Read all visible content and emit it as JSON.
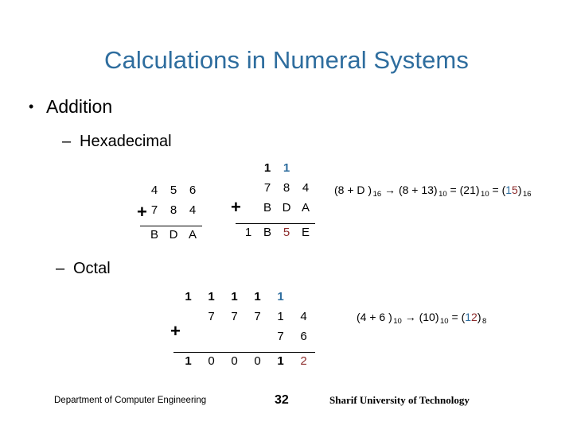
{
  "slide": {
    "title": "Calculations in Numeral Systems",
    "bullets": {
      "level1": {
        "mark": "•",
        "label": "Addition"
      },
      "hexadecimal": {
        "mark": "–",
        "label": "Hexadecimal"
      },
      "octal": {
        "mark": "–",
        "label": "Octal"
      }
    }
  },
  "hex_block_1": {
    "plus": "+",
    "carry": [
      "",
      "",
      ""
    ],
    "addend1": [
      "4",
      "5",
      "6"
    ],
    "addend2": [
      "7",
      "8",
      "4"
    ],
    "sum": [
      "B",
      "D",
      "A"
    ]
  },
  "hex_block_2": {
    "plus": "+",
    "carry": [
      "",
      "1",
      "1",
      ""
    ],
    "addend1": [
      "",
      "7",
      "8",
      "4"
    ],
    "addend2": [
      "",
      "B",
      "D",
      "A"
    ],
    "sum": [
      "1",
      "B",
      "5",
      "E"
    ],
    "carry_colors": [
      "",
      "black",
      "blue",
      ""
    ],
    "sum_colors": [
      "black",
      "black",
      "red",
      "black"
    ]
  },
  "oct_block": {
    "plus": "+",
    "carry": [
      "1",
      "1",
      "1",
      "1",
      "1",
      ""
    ],
    "addend1": [
      "",
      "7",
      "7",
      "7",
      "1",
      "4"
    ],
    "addend2": [
      "",
      "",
      "",
      "",
      "7",
      "6"
    ],
    "sum": [
      "1",
      "0",
      "0",
      "0",
      "1",
      "2"
    ],
    "carry_colors": [
      "black",
      "black",
      "black",
      "black",
      "blue",
      ""
    ],
    "sum_colors": [
      "black",
      "black",
      "black",
      "black",
      "black",
      "red"
    ]
  },
  "annotations": {
    "hex": {
      "p1": "(8 + D )",
      "s1": "16",
      "arrow": "→",
      "p2": "(8 + 13)",
      "s2": "10",
      "eq1": "=",
      "p3": "(21)",
      "s3": "10",
      "eq2": "=",
      "open": "(",
      "d_blue": "1",
      "d_red": "5",
      "close": ")",
      "s4": "16"
    },
    "oct": {
      "p1": "(4 + 6 )",
      "s1": "10",
      "arrow": "→",
      "p2": "(10)",
      "s2": "10",
      "eq1": "=",
      "open": "(",
      "d_blue": "1",
      "d_red": "2",
      "close": ")",
      "s3": "8"
    }
  },
  "footer": {
    "department": "Department of Computer Engineering",
    "page": "32",
    "university": "Sharif University of Technology"
  },
  "colors": {
    "title_blue": "#2E6D9E",
    "accent_blue": "#2E6D9E",
    "accent_red": "#8C2B2B",
    "text": "#000000",
    "background": "#FFFFFF"
  }
}
